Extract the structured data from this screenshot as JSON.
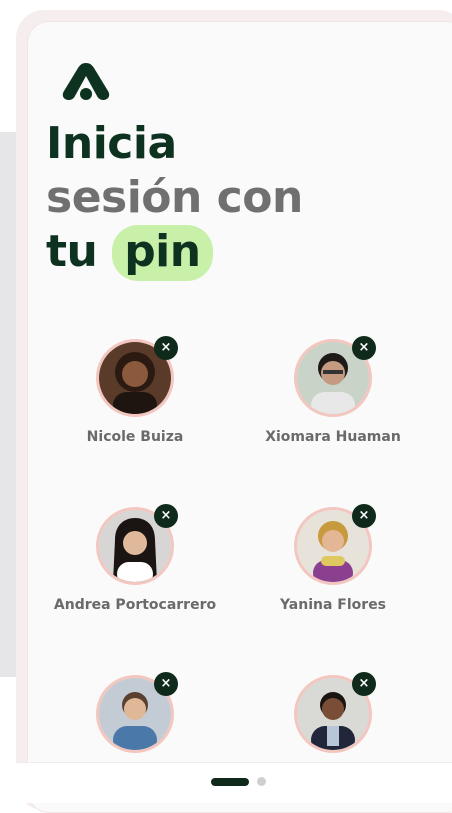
{
  "header": {
    "logo_icon": "brand-a-logo",
    "title_line1": "Inicia",
    "title_line2": "sesión con",
    "title_line3_prefix": "tu",
    "title_line3_highlight": "pin"
  },
  "contacts": [
    {
      "name": "Nicole Buiza",
      "remove_icon": "close-icon",
      "remove_label": "×"
    },
    {
      "name": "Xiomara Huaman",
      "remove_icon": "close-icon",
      "remove_label": "×"
    },
    {
      "name": "Andrea Portocarrero",
      "remove_icon": "close-icon",
      "remove_label": "×"
    },
    {
      "name": "Yanina Flores",
      "remove_icon": "close-icon",
      "remove_label": "×"
    },
    {
      "name": "",
      "remove_icon": "close-icon",
      "remove_label": "×"
    },
    {
      "name": "",
      "remove_icon": "close-icon",
      "remove_label": "×"
    }
  ],
  "pager": {
    "pages": 2,
    "active": 1
  },
  "colors": {
    "brand_dark": "#0d3320",
    "muted_text": "#707070",
    "highlight": "#c8f0a8",
    "avatar_ring": "#f3c7c0"
  }
}
